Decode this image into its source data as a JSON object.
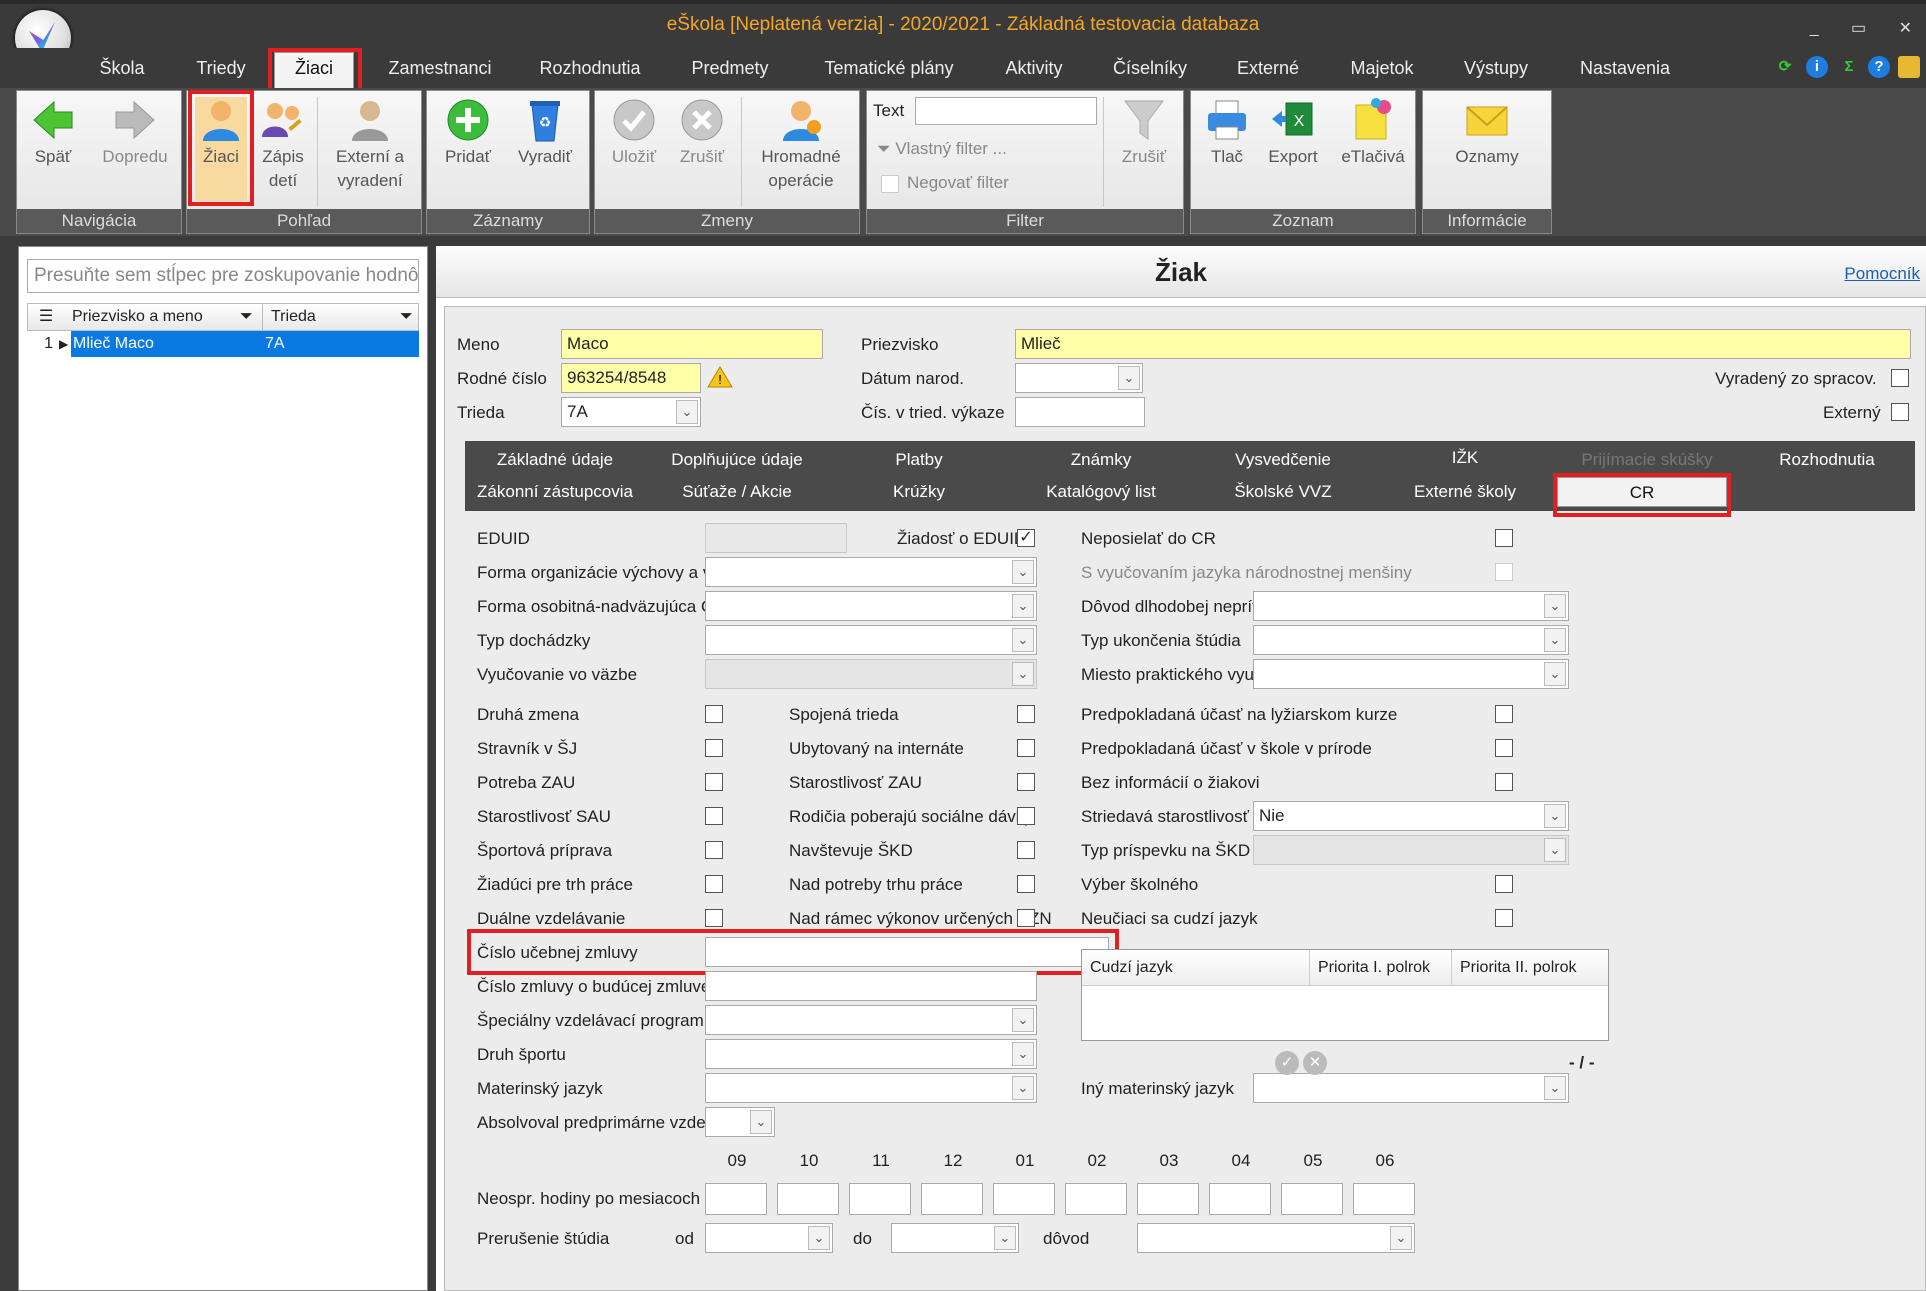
{
  "window": {
    "title": "eŠkola [Neplatená verzia] - 2020/2021 - Základná testovacia databaza",
    "controls": "_ ▭ ✕"
  },
  "menu": {
    "tabs": [
      "Škola",
      "Triedy",
      "Žiaci",
      "Zamestnanci",
      "Rozhodnutia",
      "Predmety",
      "Tematické plány",
      "Aktivity",
      "Číselníky",
      "Externé",
      "Majetok",
      "Výstupy",
      "Nastavenia"
    ],
    "active": "Žiaci"
  },
  "ribbon": {
    "navigacia": {
      "label": "Navigácia",
      "back": "Späť",
      "forward": "Dopredu"
    },
    "pohlad": {
      "label": "Pohľad",
      "ziaci": "Žiaci",
      "zapis_1": "Zápis",
      "zapis_2": "detí",
      "externi_1": "Externí a",
      "externi_2": "vyradení"
    },
    "zaznamy": {
      "label": "Záznamy",
      "add": "Pridať",
      "remove": "Vyradiť"
    },
    "zmeny": {
      "label": "Zmeny",
      "save": "Uložiť",
      "cancel": "Zrušiť",
      "hromadne_1": "Hromadné",
      "hromadne_2": "operácie"
    },
    "filter": {
      "label": "Filter",
      "text_label": "Text",
      "text_value": "",
      "vlastny": "Vlastný filter ...",
      "negovat": "Negovať filter",
      "zrusit": "Zrušiť"
    },
    "zoznam": {
      "label": "Zoznam",
      "print": "Tlač",
      "export": "Export",
      "etlaciva": "eTlačivá"
    },
    "informacie": {
      "label": "Informácie",
      "oznamy": "Oznamy"
    }
  },
  "left_panel": {
    "group_hint": "Presuňte sem stĺpec pre zoskupovanie hodnôt",
    "columns": [
      "Priezvisko a meno",
      "Trieda"
    ],
    "rows": [
      {
        "num": "1",
        "name": "Mlieč Maco",
        "class": "7A"
      }
    ]
  },
  "student": {
    "title": "Žiak",
    "helper_link": "Pomocník",
    "meno_label": "Meno",
    "meno": "Maco",
    "priezvisko_label": "Priezvisko",
    "priezvisko": "Mlieč",
    "rodne_cislo_label": "Rodné číslo",
    "rodne_cislo": "963254/8548",
    "datum_label": "Dátum narod.",
    "datum": "",
    "vyradeny_label": "Vyradený zo spracov.",
    "trieda_label": "Trieda",
    "trieda": "7A",
    "cis_label": "Čís. v tried. výkaze",
    "cis": "",
    "externy_label": "Externý"
  },
  "tabs": {
    "row1": [
      "Základné údaje",
      "Doplňujúce údaje",
      "Platby",
      "Známky",
      "Vysvedčenie",
      "IŽK",
      "Prijímacie skúšky",
      "Rozhodnutia"
    ],
    "row2": [
      "Zákonní zástupcovia",
      "Súťaže / Akcie",
      "Krúžky",
      "Katalógový list",
      "Školské VVZ",
      "Externé školy",
      "CR"
    ],
    "active": "CR"
  },
  "cr": {
    "eduid_label": "EDUID",
    "ziadost_label": "Žiadosť o EDUID",
    "neposielat_label": "Neposielať do CR",
    "forma_org_label": "Forma organizácie výchovy a vzdel.",
    "s_vyuc_label": "S vyučovaním jazyka národnostnej menšiny",
    "forma_osob_label": "Forma osobitná-nadväzujúca OVP",
    "dovod_label": "Dôvod dlhodobej neprítom.",
    "typ_doch_label": "Typ dochádzky",
    "typ_ukonc_label": "Typ ukončenia štúdia",
    "vyuc_vazbe_label": "Vyučovanie vo väzbe",
    "miesto_label": "Miesto praktického vyuč.",
    "checks_col1": [
      "Druhá zmena",
      "Stravník v ŠJ",
      "Potreba ZAU",
      "Starostlivosť SAU",
      "Športová príprava",
      "Žiadúci pre trh práce",
      "Duálne vzdelávanie"
    ],
    "checks_col2": [
      "Spojená trieda",
      "Ubytovaný na internáte",
      "Starostlivosť ZAU",
      "Rodičia poberajú sociálne dávky",
      "Navštevuje ŠKD",
      "Nad potreby trhu práce",
      "Nad rámec výkonov určených VZN"
    ],
    "checks_col3": [
      "Predpokladaná účasť na lyžiarskom kurze",
      "Predpokladaná účasť v škole v prírode",
      "Bez informácií o žiakovi"
    ],
    "striedava_label": "Striedavá starostlivosť",
    "striedava_value": "Nie",
    "typ_prisp_label": "Typ príspevku na ŠKD",
    "vyber_label": "Výber školného",
    "neuciaci_label": "Neučiaci sa cudzí jazyk",
    "cislo_ucebnej_label": "Číslo učebnej zmluvy",
    "cislo_buducej_label": "Číslo zmluvy o budúcej zmluve",
    "specialny_label": "Špeciálny vzdelávací program",
    "druh_sportu_label": "Druh športu",
    "materinsky_label": "Materinský jazyk",
    "iny_mat_label": "Iný materinský jazyk",
    "absolvoval_label": "Absolvoval predprimárne vzdel.",
    "lang_cols": [
      "Cudzí jazyk",
      "Priorita I. polrok",
      "Priorita II. polrok"
    ],
    "lang_pager": "- / -",
    "months": [
      "09",
      "10",
      "11",
      "12",
      "01",
      "02",
      "03",
      "04",
      "05",
      "06"
    ],
    "neospr_label": "Neospr. hodiny po mesiacoch",
    "prerusenie_label": "Prerušenie štúdia",
    "od_label": "od",
    "do_label": "do",
    "dovod2_label": "dôvod"
  }
}
